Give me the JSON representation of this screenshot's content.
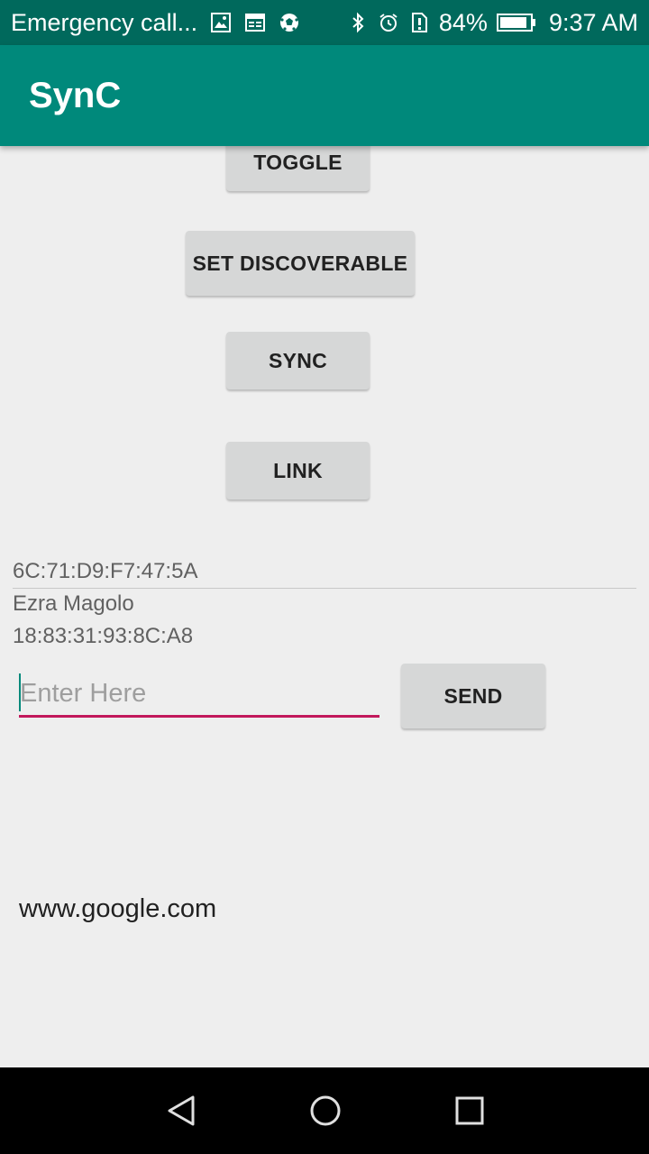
{
  "status_bar": {
    "carrier_text": "Emergency call...",
    "left_icons": [
      "image-icon",
      "calendar-icon",
      "soccer-ball-icon"
    ],
    "right_icons": [
      "bluetooth-icon",
      "alarm-icon",
      "sim-alert-icon",
      "battery-icon"
    ],
    "battery_percent": "84%",
    "time": "9:37 AM"
  },
  "app_bar": {
    "title": "SynC"
  },
  "buttons": {
    "toggle": "TOGGLE",
    "set_discoverable": "SET DISCOVERABLE",
    "sync": "SYNC",
    "link": "LINK",
    "send": "SEND"
  },
  "device_info": {
    "local_address": "6C:71:D9:F7:47:5A",
    "device_name": "Ezra Magolo",
    "device_address": "18:83:31:93:8C:A8"
  },
  "message_input": {
    "placeholder": "Enter Here",
    "value": ""
  },
  "received_text": "www.google.com",
  "colors": {
    "status_bar": "#00695c",
    "app_bar": "#00897b",
    "input_underline": "#c2185b",
    "button_bg": "#d6d7d7",
    "background": "#eeeeee"
  },
  "nav_bar": {
    "icons": [
      "back-icon",
      "home-icon",
      "recents-icon"
    ]
  }
}
